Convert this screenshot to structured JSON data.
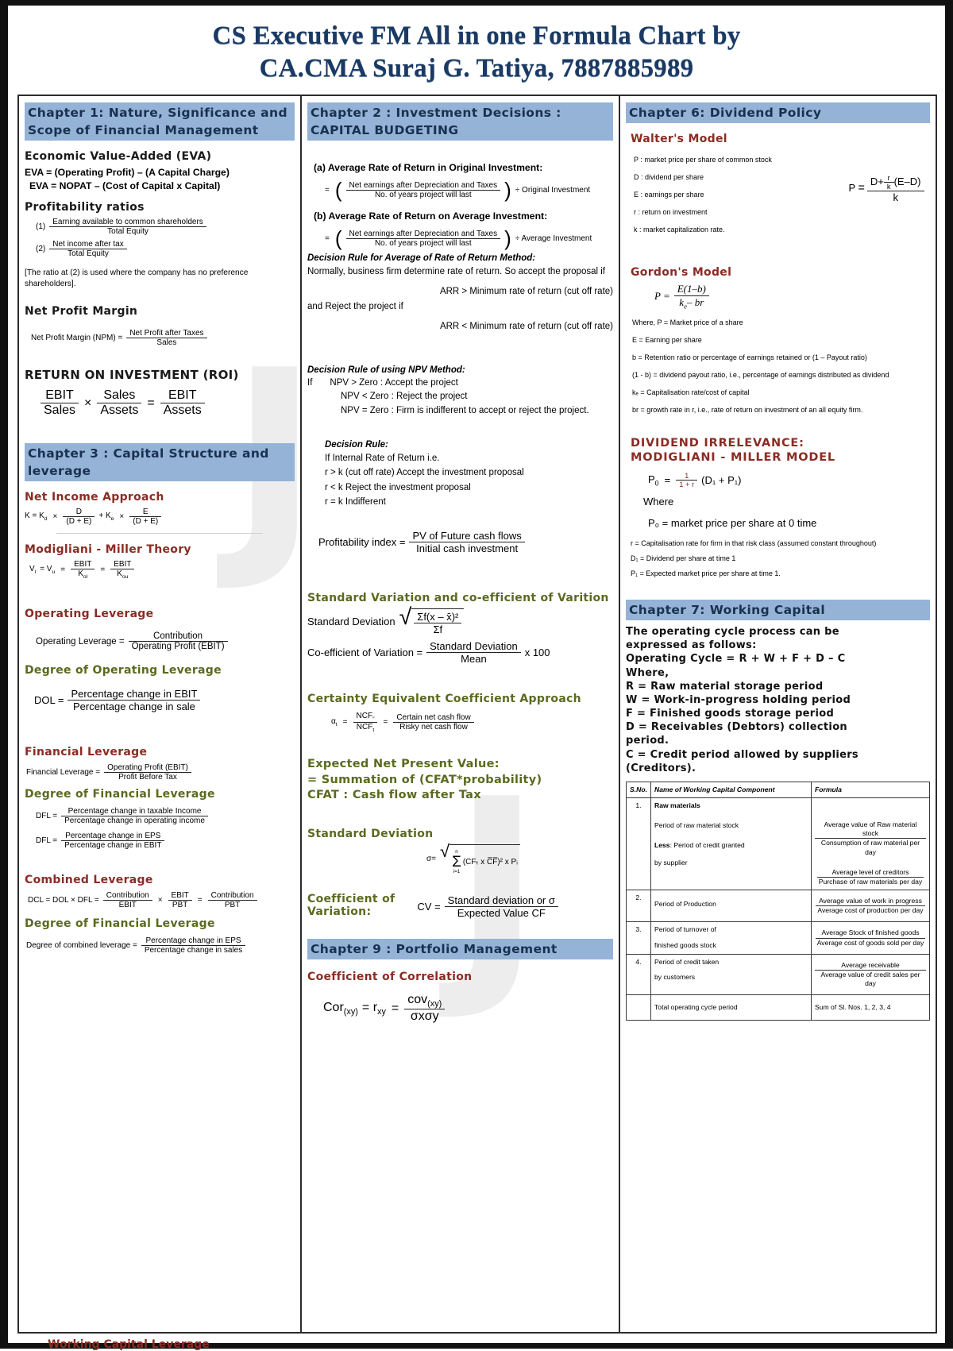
{
  "title": {
    "line1": "CS Executive FM All in one Formula Chart by",
    "line2": "CA.CMA Suraj G. Tatiya, 7887885989"
  },
  "colors": {
    "header_band": "#95b3d7",
    "heading_blue": "#18314f",
    "subheading_red": "#8a2c24",
    "subheading_green": "#5a6a1f",
    "title_navy": "#1a3a63"
  },
  "watermark": "J",
  "column1": {
    "chapter1_header": "Chapter 1: Nature, Significance and Scope of Financial Management",
    "eva": {
      "heading": "Economic Value-Added (EVA)",
      "line1": "EVA = (Operating Profit)  –  (A Capital Charge)",
      "line2": "EVA = NOPAT  –  (Cost of Capital  x  Capital)"
    },
    "profitability": {
      "heading": "Profitability ratios",
      "ratio1_label": "(1)",
      "ratio1_num": "Earning available to common shareholders",
      "ratio1_den": "Total Equity",
      "ratio2_label": "(2)",
      "ratio2_num": "Net income after tax",
      "ratio2_den": "Total Equity",
      "note": "[The ratio at (2) is used where the company has no preference shareholders]."
    },
    "npm": {
      "heading": "Net Profit Margin",
      "lhs": "Net Profit Margin (NPM)  =",
      "num": "Net Profit after Taxes",
      "den": "Sales"
    },
    "roi": {
      "heading": "RETURN ON INVESTMENT (ROI)",
      "f1_num": "EBIT",
      "f1_den": "Sales",
      "op1": "×",
      "f2_num": "Sales",
      "f2_den": "Assets",
      "op2": "=",
      "f3_num": "EBIT",
      "f3_den": "Assets"
    },
    "chapter3_header": "Chapter 3 : Capital Structure and leverage",
    "net_income_approach": {
      "heading": "Net Income Approach",
      "lhs": "K = K",
      "lhs_sub": "d",
      "times": "×",
      "f1_num": "D",
      "f1_den": "(D + E)",
      "plus": "+ K",
      "plus_sub": "e",
      "times2": "×",
      "f2_num": "E",
      "f2_den": "(D + E)"
    },
    "mm_theory": {
      "heading": "Modigliani - Miller Theory",
      "lhs": "V",
      "lhs_sub": "l",
      "eq1": "= V",
      "eq1_sub": "u",
      "eq2": "=",
      "f1_num": "EBIT",
      "f1_den_main": "K",
      "f1_den_sub": "ol",
      "eq3": "=",
      "f2_num": "EBIT",
      "f2_den_main": "K",
      "f2_den_sub": "ou"
    },
    "operating_leverage": {
      "heading": "Operating Leverage",
      "lhs": "Operating Leverage =",
      "num": "Contribution",
      "den": "Operating Profit  (EBIT)"
    },
    "dol": {
      "heading": "Degree of Operating Leverage",
      "lhs": "DOL  =",
      "num": "Percentage change in EBIT",
      "den": "Percentage change in sale"
    },
    "financial_leverage": {
      "heading": "Financial Leverage",
      "lhs": "Financial Leverage =",
      "num": "Operating Profit (EBIT)",
      "den": "Profit Before Tax"
    },
    "dfl": {
      "heading": "Degree of Financial Leverage",
      "f1_lhs": "DFL =",
      "f1_num": "Percentage change in taxable Income",
      "f1_den": "Percentage change in operating income",
      "f2_lhs": "DFL =",
      "f2_num": "Percentage change in EPS",
      "f2_den": "Percentage change in EBIT"
    },
    "combined_leverage": {
      "heading": "Combined Leverage",
      "lhs": "DCL = DOL × DFL =",
      "f1_num": "Contribution",
      "f1_den": "EBIT",
      "op1": "×",
      "f2_num": "EBIT",
      "f2_den": "PBT",
      "op2": "=",
      "f3_num": "Contribution",
      "f3_den": "PBT"
    },
    "dcl": {
      "heading": "Degree of Financial Leverage",
      "lhs": "Degree of combined leverage =",
      "num": "Percentage change in EPS",
      "den": "Percentage change in sales"
    },
    "working_capital_leverage": "Working Capital Leverage"
  },
  "column2": {
    "chapter2_header": "Chapter 2 : Investment Decisions : CAPITAL BUDGETING",
    "arr_a": {
      "label": "(a)  Average Rate of Return in Original Investment:",
      "eq": "=",
      "num": "Net earnings after Depreciation and Taxes",
      "den": "No. of years project will last",
      "tail": "÷  Original Investment"
    },
    "arr_b": {
      "label": "(b)  Average Rate of Return on Average Investment:",
      "eq": "=",
      "num": "Net earnings after Depreciation and Taxes",
      "den": "No. of years project will last",
      "tail": "÷  Average Investment"
    },
    "arr_rule": {
      "heading": "Decision Rule for Average of Rate of Return Method:",
      "line1": "Normally, business firm determine rate of return. So accept the proposal if",
      "line2": "ARR > Minimum rate of return (cut off rate)",
      "line3": "and Reject the project if",
      "line4": "ARR < Minimum rate of return (cut off rate)"
    },
    "npv_rule": {
      "heading": "Decision Rule of using NPV Method:",
      "if": "If",
      "line1": "NPV > Zero : Accept the project",
      "line2": "NPV < Zero : Reject the project",
      "line3": "NPV = Zero : Firm is indifferent to accept or reject the project."
    },
    "irr_rule": {
      "heading": "Decision Rule:",
      "line1": "If Internal Rate of Return i.e.",
      "line2": "r > k (cut off rate) Accept the investment proposal",
      "line3": "r < k Reject the investment proposal",
      "line4": "r = k Indifferent"
    },
    "pi": {
      "lhs": "Profitability index  =",
      "num": "PV of Future cash flows",
      "den": "Initial cash investment"
    },
    "std_var": {
      "heading": "Standard Variation and co-efficient of Varition",
      "sd_lhs": "Standard Deviation",
      "sd_num": "Σf(x – x̄)²",
      "sd_den": "Σf",
      "cv_lhs": "Co-efficient of Variation =",
      "cv_num": "Standard Deviation",
      "cv_den": "Mean",
      "cv_tail": "x 100"
    },
    "certainty": {
      "heading": "Certainty Equivalent Coefficient Approach",
      "lhs_main": "α",
      "lhs_sub": "t",
      "eq": "=",
      "f1_num_main": "NCF",
      "f1_num_sub": "″",
      "f1_den_main": "NCF",
      "f1_den_sub": "t",
      "eq2": "=",
      "f2_num": "Certain net cash flow",
      "f2_den": "Risky net cash flow"
    },
    "enpv": {
      "line1": "Expected Net Present Value:",
      "line2": "= Summation of (CFAT*probability)",
      "line3": "CFAT : Cash flow after Tax"
    },
    "sd2": {
      "heading": "Standard Deviation",
      "formula_lhs": "σ=",
      "sum_top": "n",
      "sum_sym": "Σ",
      "sum_bot": "i=1",
      "body": "(CFₜ x C̅F̅)² x Pᵢ"
    },
    "cv2": {
      "heading_l1": "Coefficient of",
      "heading_l2": "Variation:",
      "lhs": "CV =",
      "num": "Standard deviation or σ",
      "den": "Expected Value CF"
    },
    "chapter9_header": "Chapter 9 : Portfolio Management",
    "correlation": {
      "heading": "Coefficient of Correlation",
      "lhs1": "Cor",
      "lhs1_sub": "(xy)",
      "eq1": "= r",
      "lhs2_sub": "xy",
      "eq2": "=",
      "num": "cov",
      "num_sub": "(xy)",
      "den": "σxσy"
    }
  },
  "column3": {
    "chapter6_header": "Chapter 6: Dividend Policy",
    "walter": {
      "heading": "Walter's Model",
      "defs": [
        "P : market price per share of common stock",
        "D : dividend per share",
        "E : earnings per share",
        "r : return on investment",
        "k  : market capitalization rate."
      ],
      "formula_lhs": "P =",
      "formula_num": "D + (r/k)(E–D)",
      "formula_den": "k",
      "f_D": "D+",
      "f_r": "r",
      "f_k": "k",
      "f_ed": "(E–D)",
      "f_bot": "k"
    },
    "gordon": {
      "heading": "Gordon's Model",
      "lhs": "P =",
      "num": "E(1–b)",
      "den_main": "k",
      "den_sub": "e",
      "den_rest": "– br",
      "defs": [
        "Where, P = Market price of a share",
        "E = Earning per share",
        "b = Retention ratio or percentage of earnings retained or (1 – Payout ratio)",
        "(1 - b) = dividend payout ratio, i.e., percentage of earnings distributed as dividend",
        "kₑ = Capitalisation rate/cost of capital",
        "br = growth rate in r, i.e., rate of return on investment of an all equity firm."
      ]
    },
    "mm_dividend": {
      "heading_l1": "DIVIDEND IRRELEVANCE:",
      "heading_l2": "MODIGLIANI - MILLER MODEL",
      "formula_p": "P",
      "formula_p_sub": "0",
      "formula_eq": "=",
      "formula_num": "1",
      "formula_den": "1 + r",
      "formula_tail": "(D₁ + P₁)",
      "where": "Where",
      "where_line": "P₀ = market price per share at 0 time",
      "defs": [
        "r = Capitalisation rate for firm in that risk class (assumed constant throughout)",
        "D₁ = Dividend per share at time 1",
        "P₁ = Expected market price per share at time 1."
      ]
    },
    "chapter7_header": "Chapter 7: Working Capital",
    "working_capital": {
      "intro": [
        "The operating cycle process can be",
        "expressed as follows:",
        "Operating Cycle = R + W + F + D – C",
        "Where,",
        "R = Raw material storage period",
        "W = Work-in-progress holding period",
        "F = Finished goods storage period",
        "D = Receivables (Debtors) collection",
        "period.",
        "C = Credit period allowed by suppliers",
        "(Creditors)."
      ],
      "table": {
        "headers": [
          "S.No.",
          "Name of Working Capital Component",
          "Formula"
        ],
        "rows": [
          {
            "no": "1.",
            "component_title": "Raw materials",
            "component_lines": [
              "Period of raw material stock",
              "Less: Period of credit granted",
              "by supplier"
            ],
            "formula1_num": "Average value of Raw material stock",
            "formula1_den": "Consumption of raw material per day",
            "formula2_num": "Average level of creditors",
            "formula2_den": "Purchase of raw materials per day"
          },
          {
            "no": "2.",
            "component_lines": [
              "Period of Production"
            ],
            "formula1_num": "Average value of work in progress",
            "formula1_den": "Average cost of production per day"
          },
          {
            "no": "3.",
            "component_lines": [
              "Period of turnover of",
              "finished goods stock"
            ],
            "formula1_num": "Average Stock of finished goods",
            "formula1_den": "Average cost of goods sold per day"
          },
          {
            "no": "4.",
            "component_lines": [
              "Period of credit taken",
              "by customers"
            ],
            "formula1_num": "Average receivable",
            "formula1_den": "Average value of credit sales per day"
          },
          {
            "no": "",
            "component_lines": [
              "Total operating cycle period"
            ],
            "formula_plain": "Sum of Sl. Nos. 1, 2, 3, 4"
          }
        ]
      }
    }
  }
}
